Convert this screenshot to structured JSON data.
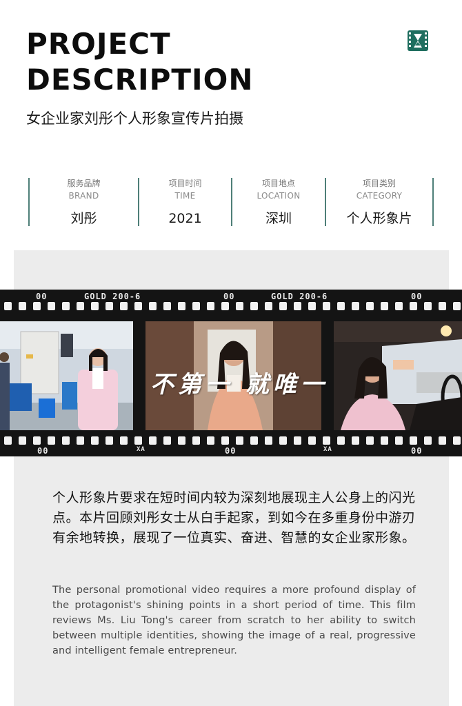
{
  "header": {
    "title_line1": "PROJECT",
    "title_line2": "DESCRIPTION",
    "subtitle": "女企业家刘彤个人形象宣传片拍摄",
    "logo_icon": "film-hourglass-icon",
    "logo_color": "#1f6e5f"
  },
  "info": [
    {
      "label_cn": "服务品牌",
      "label_en": "BRAND",
      "value": "刘彤"
    },
    {
      "label_cn": "项目时间",
      "label_en": "TIME",
      "value": "2021"
    },
    {
      "label_cn": "项目地点",
      "label_en": "LOCATION",
      "value": "深圳"
    },
    {
      "label_cn": "项目类别",
      "label_en": "CATEGORY",
      "value": "个人形象片"
    }
  ],
  "film": {
    "codes_top": [
      "00",
      "GOLD 200-6",
      "00",
      "GOLD 200-6",
      "00"
    ],
    "codes_bottom": [
      "00",
      "XA",
      "00",
      "XA",
      "00"
    ],
    "overlay_text": "不第一  就唯一",
    "frames": [
      "factory-scene",
      "portrait-scene",
      "car-driving-scene"
    ]
  },
  "description": {
    "cn": "个人形象片要求在短时间内较为深刻地展现主人公身上的闪光点。本片回顾刘彤女士从白手起家，到如今在多重身份中游刃有余地转换，展现了一位真实、奋进、智慧的女企业家形象。",
    "en": "The personal promotional video requires a more profound display of the protagonist's shining points in a short period of time. This film reviews Ms. Liu Tong's career from scratch to her ability to switch between multiple identities, showing the image of a real, progressive and intelligent female entrepreneur."
  },
  "colors": {
    "accent": "#4e7f78",
    "panel": "#ececec",
    "film": "#141414"
  }
}
